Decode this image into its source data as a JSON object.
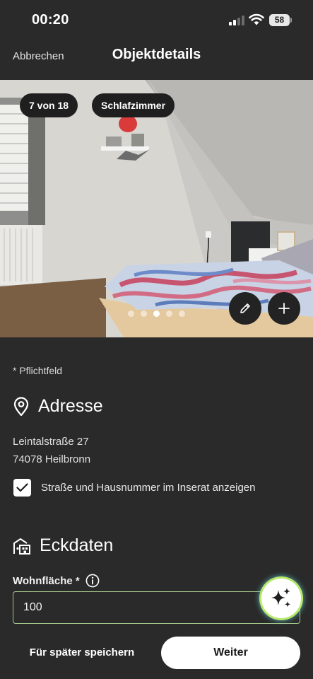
{
  "status_bar": {
    "time": "00:20",
    "battery": "58"
  },
  "header": {
    "cancel_label": "Abbrechen",
    "title": "Objektdetails"
  },
  "photo": {
    "counter": "7 von 18",
    "room_label": "Schlafzimmer",
    "edit_icon": "pencil-icon",
    "add_icon": "plus-icon",
    "dots_total": 5,
    "dot_active": 2
  },
  "form": {
    "required_hint": "* Pflichtfeld",
    "address": {
      "heading": "Adresse",
      "icon": "location-pin-icon",
      "street": "Leintalstraße 27",
      "city": "74078 Heilbronn",
      "show_address_label": "Straße und Hausnummer im Inserat anzeigen",
      "show_address_checked": true
    },
    "key_data": {
      "heading": "Eckdaten",
      "icon": "building-icon",
      "living_area_label": "Wohnfläche *",
      "living_area_value": "100"
    }
  },
  "ai_button": {
    "icon": "sparkles-icon"
  },
  "footer": {
    "save_later_label": "Für später speichern",
    "next_label": "Weiter"
  },
  "colors": {
    "background": "#2a2a2a",
    "input_border": "#a6c88a",
    "ai_glow": "#b7e86a"
  }
}
